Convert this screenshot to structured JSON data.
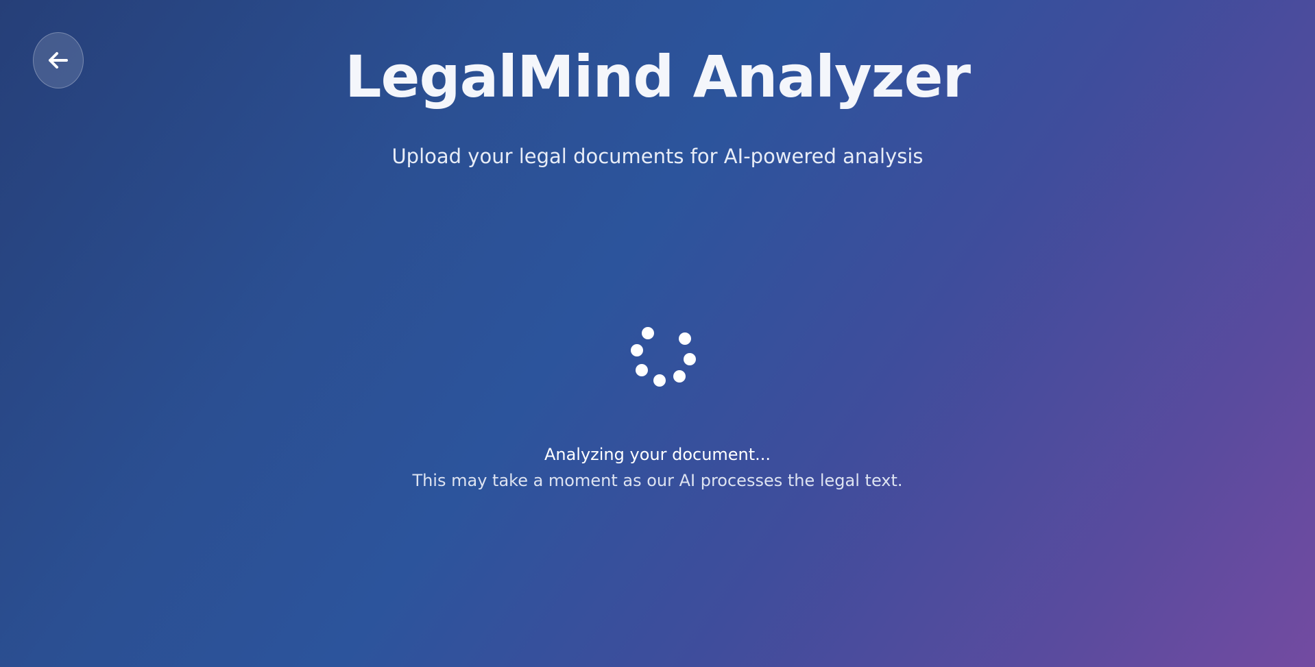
{
  "header": {
    "title": "LegalMind Analyzer",
    "subtitle": "Upload your legal documents for AI-powered analysis"
  },
  "navigation": {
    "back_icon": "arrow-left-icon"
  },
  "status": {
    "title": "Analyzing your document...",
    "detail": "This may take a moment as our AI processes the legal text."
  },
  "theme": {
    "gradient_start": "#263f78",
    "gradient_mid": "#2c549c",
    "gradient_end": "#734ba1",
    "text_color": "#ffffff"
  }
}
